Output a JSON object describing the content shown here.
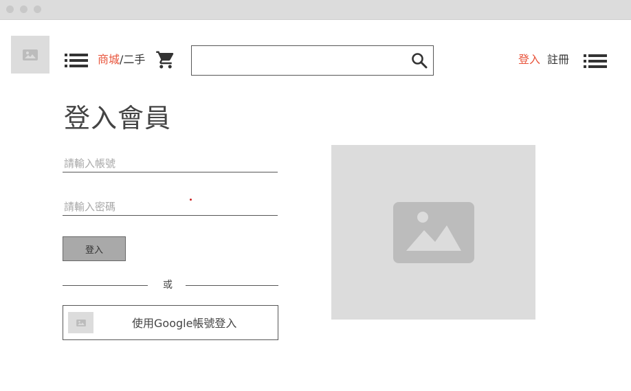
{
  "header": {
    "breadcrumb": {
      "link": "商城",
      "separator": "/",
      "current": "二手"
    },
    "search": {
      "placeholder": "",
      "value": ""
    },
    "auth": {
      "login": "登入",
      "register": "註冊"
    },
    "accent_color": "#e8533a"
  },
  "login_form": {
    "title": "登入會員",
    "account_placeholder": "請輸入帳號",
    "password_placeholder": "請輸入密碼",
    "submit_label": "登入",
    "divider_text": "或",
    "google_label": "使用Google帳號登入"
  },
  "icons": {
    "logo": "image-placeholder-icon",
    "left_menu": "list-menu-icon",
    "cart": "shopping-cart-icon",
    "search": "search-icon",
    "right_menu": "list-menu-icon",
    "google": "image-placeholder-icon",
    "hero": "image-placeholder-icon"
  }
}
